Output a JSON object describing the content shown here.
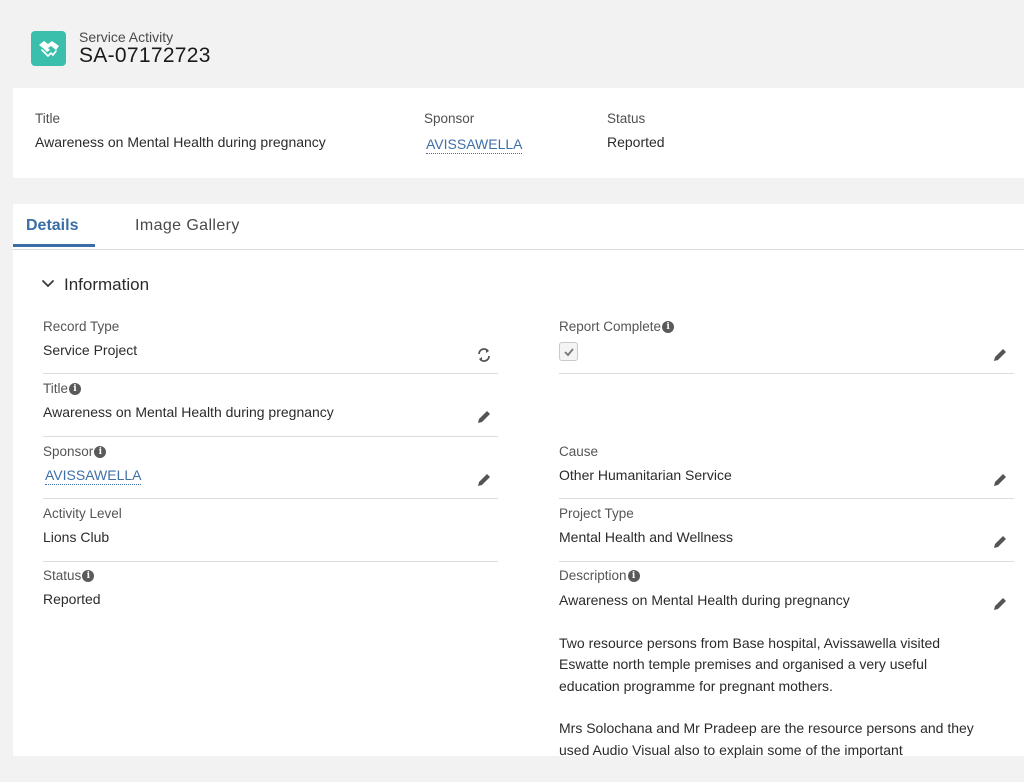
{
  "header": {
    "object_type": "Service Activity",
    "record_name": "SA-07172723",
    "icon": "handshake-icon",
    "icon_color": "#3bbfad"
  },
  "highlights": {
    "title_label": "Title",
    "title_value": "Awareness on Mental Health during pregnancy",
    "sponsor_label": "Sponsor",
    "sponsor_value": "AVISSAWELLA",
    "status_label": "Status",
    "status_value": "Reported"
  },
  "tabs": [
    {
      "label": "Details",
      "active": true
    },
    {
      "label": "Image Gallery",
      "active": false
    }
  ],
  "section": {
    "title": "Information"
  },
  "fields": {
    "record_type_label": "Record Type",
    "record_type_value": "Service Project",
    "report_complete_label": "Report Complete",
    "report_complete_checked": true,
    "title_label": "Title",
    "title_value": "Awareness on Mental Health during pregnancy",
    "sponsor_label": "Sponsor",
    "sponsor_value": "AVISSAWELLA",
    "cause_label": "Cause",
    "cause_value": "Other Humanitarian Service",
    "activity_level_label": "Activity Level",
    "activity_level_value": "Lions Club",
    "project_type_label": "Project Type",
    "project_type_value": "Mental Health and Wellness",
    "status_label": "Status",
    "status_value": "Reported",
    "description_label": "Description",
    "description_paragraphs": [
      "Awareness on Mental Health during pregnancy",
      "Two resource persons from Base hospital, Avissawella visited Eswatte north temple premises and organised a very useful education programme for pregnant mothers.",
      "Mrs Solochana and Mr Pradeep are the resource persons and they used Audio Visual also to explain some of the important"
    ]
  },
  "colors": {
    "accent": "#3a6ea5",
    "link": "#3f6fa8",
    "page_bg": "#f3f2f2"
  }
}
